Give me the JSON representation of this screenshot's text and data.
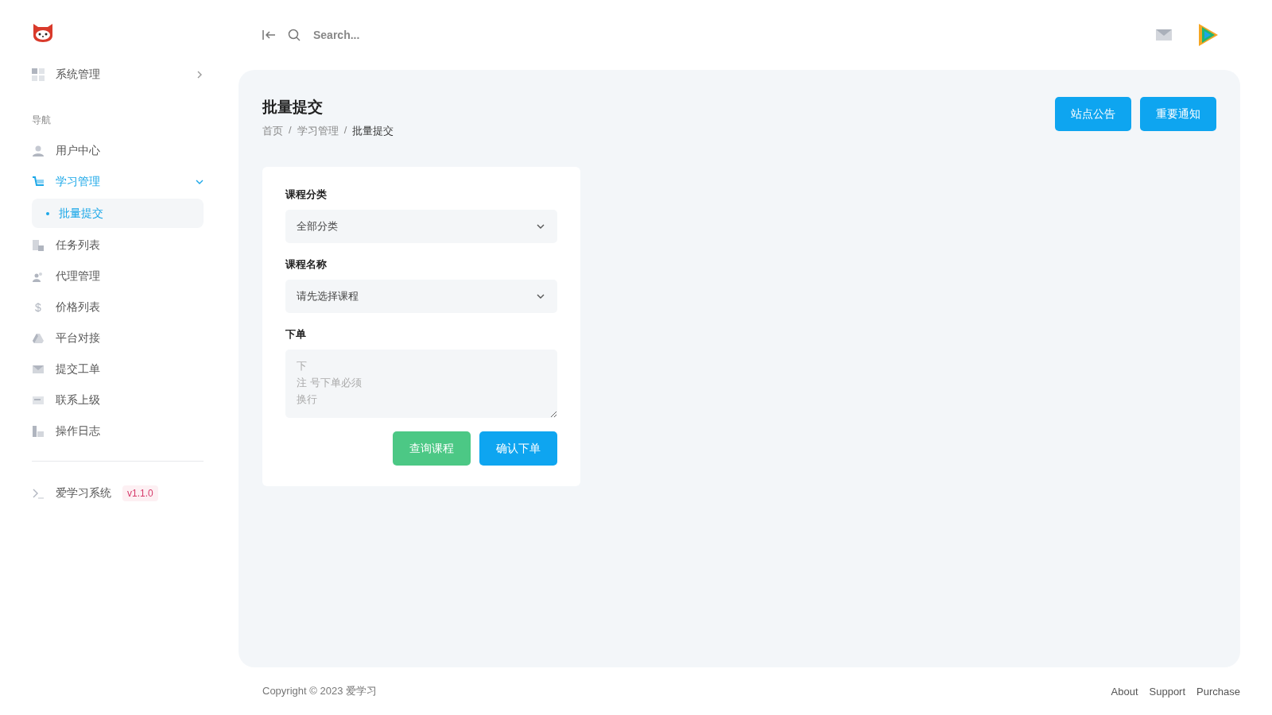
{
  "sidebar": {
    "top_item": {
      "label": "系统管理"
    },
    "section_title": "导航",
    "items": [
      {
        "label": "用户中心",
        "selected": false
      },
      {
        "label": "学习管理",
        "selected": true,
        "expanded": true,
        "children": [
          {
            "label": "批量提交",
            "selected": true
          }
        ]
      },
      {
        "label": "任务列表",
        "selected": false
      },
      {
        "label": "代理管理",
        "selected": false
      },
      {
        "icon_text": "$",
        "label": "价格列表",
        "selected": false
      },
      {
        "label": "平台对接",
        "selected": false
      },
      {
        "label": "提交工单",
        "selected": false
      },
      {
        "label": "联系上级",
        "selected": false
      },
      {
        "label": "操作日志",
        "selected": false
      }
    ],
    "footer": {
      "label": "爱学习系统",
      "version": "v1.1.0"
    }
  },
  "topbar": {
    "search": {
      "placeholder": "Search..."
    }
  },
  "page": {
    "title": "批量提交",
    "breadcrumb": [
      {
        "label": "首页"
      },
      {
        "separator": "/",
        "label": "学习管理"
      },
      {
        "separator": "/",
        "label": "批量提交"
      }
    ],
    "buttons": [
      "站点公告",
      "重要通知"
    ]
  },
  "form": {
    "fields": [
      {
        "kind": "select",
        "label": "课程分类",
        "value": "全部分类"
      },
      {
        "kind": "select",
        "label": "课程名称",
        "value": "请先选择课程"
      },
      {
        "kind": "textarea",
        "label": "下单",
        "placeholder_lines": [
          "下",
          "注 号下单必须",
          "换行"
        ]
      }
    ],
    "buttons": [
      {
        "label": "查询课程",
        "kind": "secondary"
      },
      {
        "label": "确认下单",
        "kind": "primary"
      }
    ]
  },
  "footer": {
    "copyright": "Copyright © 2023 爱学习",
    "links": [
      "About",
      "Support",
      "Purchase"
    ]
  }
}
